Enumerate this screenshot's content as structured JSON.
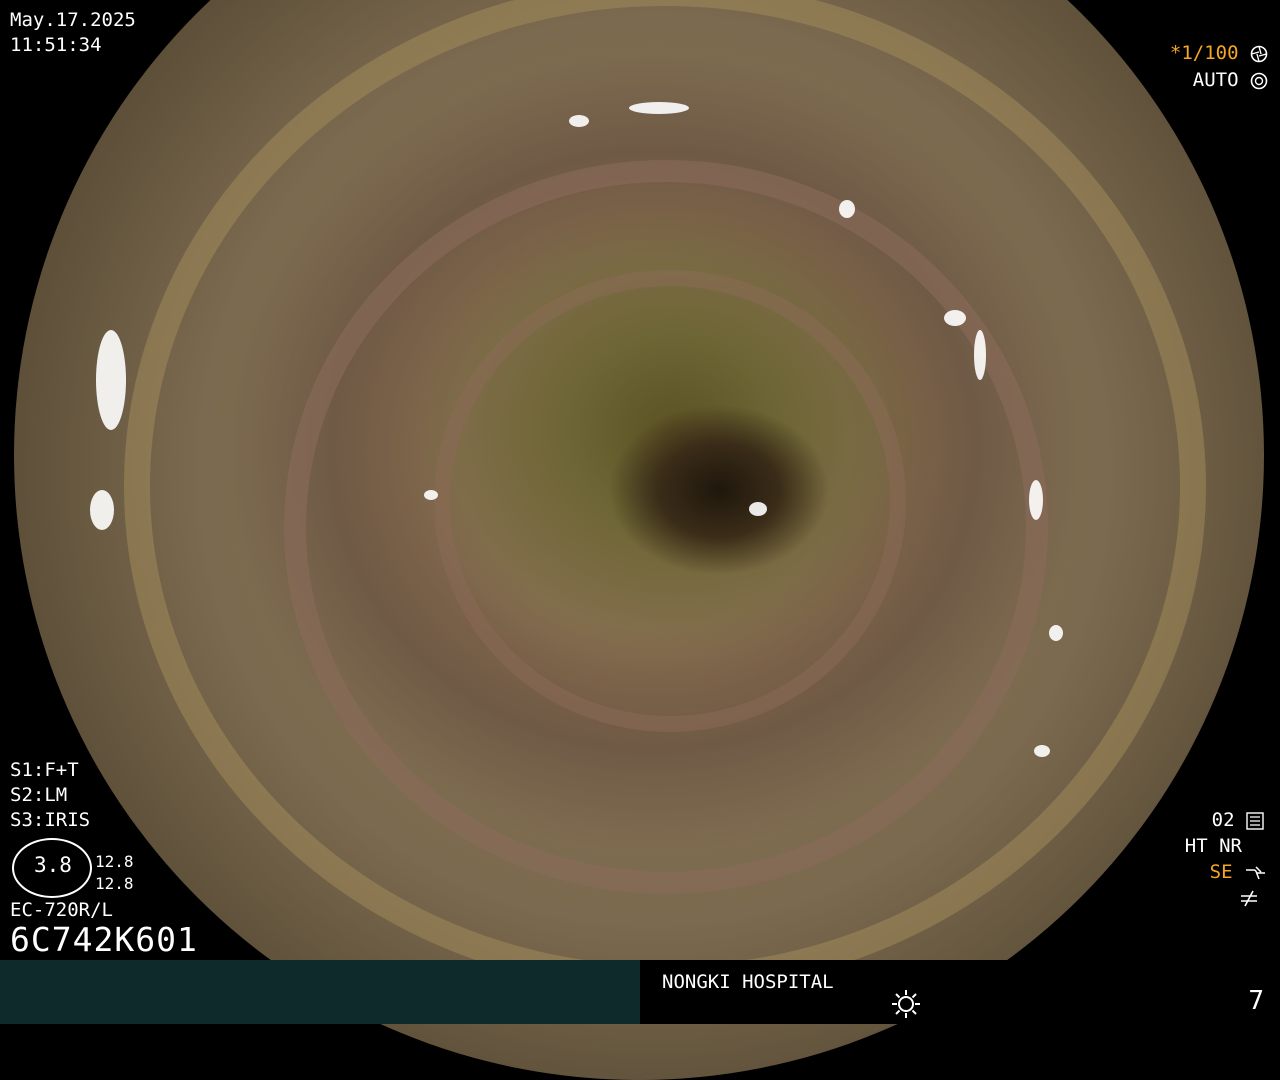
{
  "datetime": {
    "date": "May.17.2025",
    "time": "11:51:34"
  },
  "top_right": {
    "shutter": "*1/100",
    "shutter_icon": "aperture-icon",
    "mode": "AUTO",
    "mode_icon": "iris-icon"
  },
  "settings_left": {
    "s1": "S1:F+T",
    "s2": "S2:LM",
    "s3": "S3:IRIS"
  },
  "scale": {
    "center": "3.8",
    "upper": "12.8",
    "lower": "12.8"
  },
  "scope": {
    "model": "EC-720R/L",
    "serial": "6C742K601"
  },
  "bottom_right_status": {
    "line1": "02",
    "line1_icon": "settings-sliders-icon",
    "line2": "HT NR",
    "line3": "SE",
    "line3_icon": "enhancement-curve-icon",
    "line4_icon": "not-equal-icon"
  },
  "footer": {
    "hospital": "NONGKI HOSPITAL",
    "light_icon": "brightness-icon",
    "page": "7"
  },
  "colors": {
    "accent": "#f5a623",
    "footer_left": "#0f2a2a"
  }
}
